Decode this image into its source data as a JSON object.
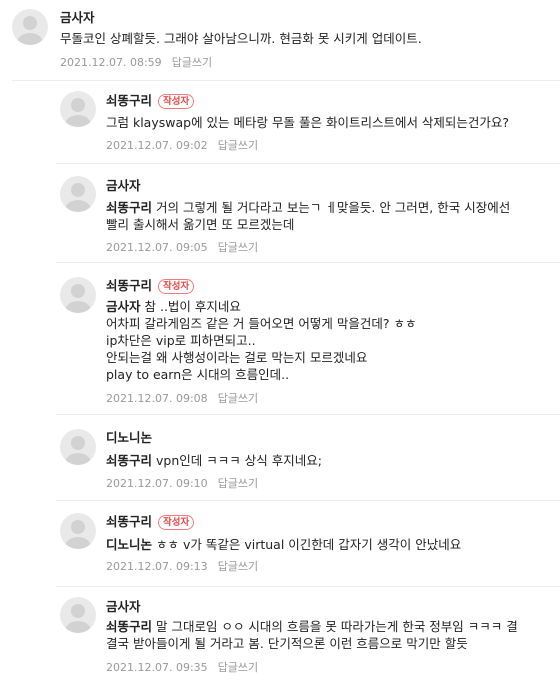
{
  "comments": [
    {
      "author": "금사자",
      "badge": "",
      "mention": "",
      "lines": [
        "무돌코인 상폐할듯. 그래야 살아남으니까. 현금화 못 시키게 업데이트."
      ],
      "date": "2021.12.07. 08:59",
      "reply_label": "답글쓰기"
    },
    {
      "author": "쇠똥구리",
      "badge": "작성자",
      "mention": "",
      "lines": [
        "그럼 klayswap에 있는 메타랑 무돌 풀은 화이트리스트에서 삭제되는건가요?"
      ],
      "date": "2021.12.07. 09:02",
      "reply_label": "답글쓰기"
    },
    {
      "author": "금사자",
      "badge": "",
      "mention": "쇠똥구리",
      "lines": [
        "거의 그렇게 될 거다라고 보는ㄱ ㅔ맞을듯. 안 그러면, 한국 시장에선",
        "빨리 출시해서 옮기면 또 모르겠는데"
      ],
      "date": "2021.12.07. 09:05",
      "reply_label": "답글쓰기"
    },
    {
      "author": "쇠똥구리",
      "badge": "작성자",
      "mention": "금사자",
      "lines": [
        "참 ..법이 후지네요",
        "어차피 갈라게임즈 같은 거 들어오면 어떻게 막을건데? ㅎㅎ",
        "ip차단은 vip로 피하면되고..",
        "안되는걸 왜 사행성이라는 걸로 막는지 모르겠네요",
        "play to earn은 시대의 흐름인데.."
      ],
      "date": "2021.12.07. 09:08",
      "reply_label": "답글쓰기"
    },
    {
      "author": "디노니논",
      "badge": "",
      "mention": "쇠똥구리",
      "lines": [
        "vpn인데 ㅋㅋㅋ 상식 후지네요;"
      ],
      "date": "2021.12.07. 09:10",
      "reply_label": "답글쓰기"
    },
    {
      "author": "쇠똥구리",
      "badge": "작성자",
      "mention": "디노니논",
      "lines": [
        "ㅎㅎ v가 똑같은 virtual 이긴한데 갑자기 생각이 안났네요"
      ],
      "date": "2021.12.07. 09:13",
      "reply_label": "답글쓰기"
    },
    {
      "author": "금사자",
      "badge": "",
      "mention": "쇠똥구리",
      "lines": [
        "말 그대로임 ㅇㅇ 시대의 흐름을 못 따라가는게 한국 정부임 ㅋㅋㅋ 결",
        "결국 받아들이게 될 거라고 봄. 단기적으론 이런 흐름으로 막기만 할듯"
      ],
      "date": "2021.12.07. 09:35",
      "reply_label": "답글쓰기"
    }
  ]
}
